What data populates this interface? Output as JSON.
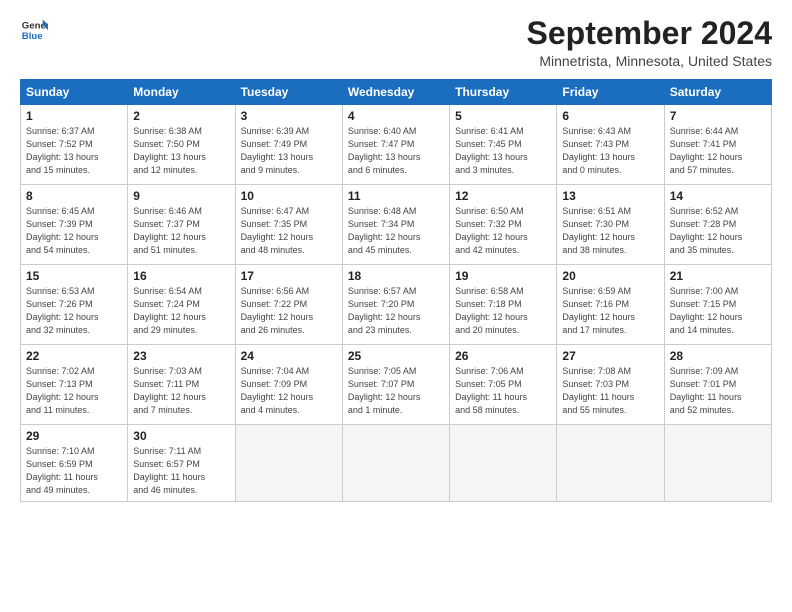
{
  "header": {
    "logo_line1": "General",
    "logo_line2": "Blue",
    "month_title": "September 2024",
    "location": "Minnetrista, Minnesota, United States"
  },
  "weekdays": [
    "Sunday",
    "Monday",
    "Tuesday",
    "Wednesday",
    "Thursday",
    "Friday",
    "Saturday"
  ],
  "weeks": [
    [
      {
        "day": "1",
        "info": "Sunrise: 6:37 AM\nSunset: 7:52 PM\nDaylight: 13 hours\nand 15 minutes."
      },
      {
        "day": "2",
        "info": "Sunrise: 6:38 AM\nSunset: 7:50 PM\nDaylight: 13 hours\nand 12 minutes."
      },
      {
        "day": "3",
        "info": "Sunrise: 6:39 AM\nSunset: 7:49 PM\nDaylight: 13 hours\nand 9 minutes."
      },
      {
        "day": "4",
        "info": "Sunrise: 6:40 AM\nSunset: 7:47 PM\nDaylight: 13 hours\nand 6 minutes."
      },
      {
        "day": "5",
        "info": "Sunrise: 6:41 AM\nSunset: 7:45 PM\nDaylight: 13 hours\nand 3 minutes."
      },
      {
        "day": "6",
        "info": "Sunrise: 6:43 AM\nSunset: 7:43 PM\nDaylight: 13 hours\nand 0 minutes."
      },
      {
        "day": "7",
        "info": "Sunrise: 6:44 AM\nSunset: 7:41 PM\nDaylight: 12 hours\nand 57 minutes."
      }
    ],
    [
      {
        "day": "8",
        "info": "Sunrise: 6:45 AM\nSunset: 7:39 PM\nDaylight: 12 hours\nand 54 minutes."
      },
      {
        "day": "9",
        "info": "Sunrise: 6:46 AM\nSunset: 7:37 PM\nDaylight: 12 hours\nand 51 minutes."
      },
      {
        "day": "10",
        "info": "Sunrise: 6:47 AM\nSunset: 7:35 PM\nDaylight: 12 hours\nand 48 minutes."
      },
      {
        "day": "11",
        "info": "Sunrise: 6:48 AM\nSunset: 7:34 PM\nDaylight: 12 hours\nand 45 minutes."
      },
      {
        "day": "12",
        "info": "Sunrise: 6:50 AM\nSunset: 7:32 PM\nDaylight: 12 hours\nand 42 minutes."
      },
      {
        "day": "13",
        "info": "Sunrise: 6:51 AM\nSunset: 7:30 PM\nDaylight: 12 hours\nand 38 minutes."
      },
      {
        "day": "14",
        "info": "Sunrise: 6:52 AM\nSunset: 7:28 PM\nDaylight: 12 hours\nand 35 minutes."
      }
    ],
    [
      {
        "day": "15",
        "info": "Sunrise: 6:53 AM\nSunset: 7:26 PM\nDaylight: 12 hours\nand 32 minutes."
      },
      {
        "day": "16",
        "info": "Sunrise: 6:54 AM\nSunset: 7:24 PM\nDaylight: 12 hours\nand 29 minutes."
      },
      {
        "day": "17",
        "info": "Sunrise: 6:56 AM\nSunset: 7:22 PM\nDaylight: 12 hours\nand 26 minutes."
      },
      {
        "day": "18",
        "info": "Sunrise: 6:57 AM\nSunset: 7:20 PM\nDaylight: 12 hours\nand 23 minutes."
      },
      {
        "day": "19",
        "info": "Sunrise: 6:58 AM\nSunset: 7:18 PM\nDaylight: 12 hours\nand 20 minutes."
      },
      {
        "day": "20",
        "info": "Sunrise: 6:59 AM\nSunset: 7:16 PM\nDaylight: 12 hours\nand 17 minutes."
      },
      {
        "day": "21",
        "info": "Sunrise: 7:00 AM\nSunset: 7:15 PM\nDaylight: 12 hours\nand 14 minutes."
      }
    ],
    [
      {
        "day": "22",
        "info": "Sunrise: 7:02 AM\nSunset: 7:13 PM\nDaylight: 12 hours\nand 11 minutes."
      },
      {
        "day": "23",
        "info": "Sunrise: 7:03 AM\nSunset: 7:11 PM\nDaylight: 12 hours\nand 7 minutes."
      },
      {
        "day": "24",
        "info": "Sunrise: 7:04 AM\nSunset: 7:09 PM\nDaylight: 12 hours\nand 4 minutes."
      },
      {
        "day": "25",
        "info": "Sunrise: 7:05 AM\nSunset: 7:07 PM\nDaylight: 12 hours\nand 1 minute."
      },
      {
        "day": "26",
        "info": "Sunrise: 7:06 AM\nSunset: 7:05 PM\nDaylight: 11 hours\nand 58 minutes."
      },
      {
        "day": "27",
        "info": "Sunrise: 7:08 AM\nSunset: 7:03 PM\nDaylight: 11 hours\nand 55 minutes."
      },
      {
        "day": "28",
        "info": "Sunrise: 7:09 AM\nSunset: 7:01 PM\nDaylight: 11 hours\nand 52 minutes."
      }
    ],
    [
      {
        "day": "29",
        "info": "Sunrise: 7:10 AM\nSunset: 6:59 PM\nDaylight: 11 hours\nand 49 minutes."
      },
      {
        "day": "30",
        "info": "Sunrise: 7:11 AM\nSunset: 6:57 PM\nDaylight: 11 hours\nand 46 minutes."
      },
      {
        "day": "",
        "info": ""
      },
      {
        "day": "",
        "info": ""
      },
      {
        "day": "",
        "info": ""
      },
      {
        "day": "",
        "info": ""
      },
      {
        "day": "",
        "info": ""
      }
    ]
  ]
}
